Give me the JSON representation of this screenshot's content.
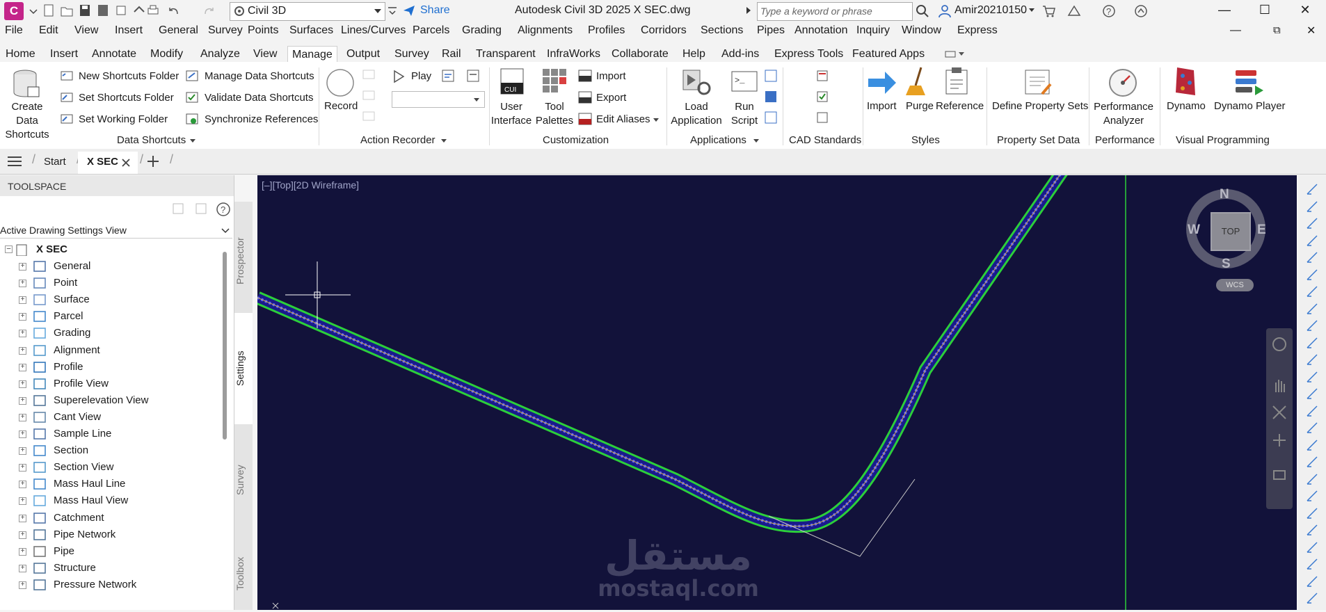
{
  "titlebar": {
    "logo": "C",
    "workspace": "Civil 3D",
    "share": "Share",
    "title": "Autodesk Civil 3D 2025    X SEC.dwg",
    "search_placeholder": "Type a keyword or phrase",
    "user": "Amir20210150"
  },
  "menubar": [
    "File",
    "Edit",
    "View",
    "Insert",
    "General",
    "Survey",
    "Points",
    "Surfaces",
    "Lines/Curves",
    "Parcels",
    "Grading",
    "Alignments",
    "Profiles",
    "Corridors",
    "Sections",
    "Pipes",
    "Annotation",
    "Inquiry",
    "Window",
    "Express"
  ],
  "ribbon_tabs": [
    "Home",
    "Insert",
    "Annotate",
    "Modify",
    "Analyze",
    "View",
    "Manage",
    "Output",
    "Survey",
    "Rail",
    "Transparent",
    "InfraWorks",
    "Collaborate",
    "Help",
    "Add-ins",
    "Express Tools",
    "Featured Apps"
  ],
  "ribbon": {
    "data_shortcuts": {
      "create": "Create Data\nShortcuts",
      "new_folder": "New Shortcuts Folder",
      "set_folder": "Set Shortcuts Folder",
      "set_working": "Set Working Folder",
      "manage": "Manage Data Shortcuts",
      "validate": "Validate Data Shortcuts",
      "sync": "Synchronize References",
      "label": "Data Shortcuts"
    },
    "action_recorder": {
      "record": "Record",
      "play": "Play",
      "label": "Action Recorder"
    },
    "customization": {
      "ui": "User\nInterface",
      "palettes": "Tool\nPalettes",
      "import": "Import",
      "export": "Export",
      "aliases": "Edit Aliases",
      "label": "Customization"
    },
    "applications": {
      "load": "Load\nApplication",
      "run": "Run\nScript",
      "label": "Applications"
    },
    "cad_standards": {
      "label": "CAD Standards"
    },
    "styles": {
      "import": "Import",
      "purge": "Purge",
      "reference": "Reference",
      "label": "Styles"
    },
    "property_set": {
      "define": "Define Property Sets",
      "label": "Property Set Data"
    },
    "performance": {
      "analyzer": "Performance\nAnalyzer",
      "label": "Performance"
    },
    "visual": {
      "dynamo": "Dynamo",
      "player": "Dynamo Player",
      "label": "Visual Programming"
    }
  },
  "file_tabs": {
    "start": "Start",
    "active": "X SEC"
  },
  "toolspace": {
    "title": "TOOLSPACE",
    "view_select": "Active Drawing Settings View",
    "root": "X SEC",
    "items": [
      "General",
      "Point",
      "Surface",
      "Parcel",
      "Grading",
      "Alignment",
      "Profile",
      "Profile View",
      "Superelevation View",
      "Cant View",
      "Sample Line",
      "Section",
      "Section View",
      "Mass Haul Line",
      "Mass Haul View",
      "Catchment",
      "Pipe Network",
      "Pipe",
      "Structure",
      "Pressure Network"
    ],
    "side_tabs": [
      "Prospector",
      "Settings",
      "Survey",
      "Toolbox"
    ]
  },
  "viewport": {
    "label": "[–][Top][2D Wireframe]",
    "compass": {
      "n": "N",
      "s": "S",
      "e": "E",
      "w": "W",
      "top": "TOP",
      "wcs": "WCS"
    },
    "watermark_ar": "مستقل",
    "watermark": "mostaql.com"
  }
}
